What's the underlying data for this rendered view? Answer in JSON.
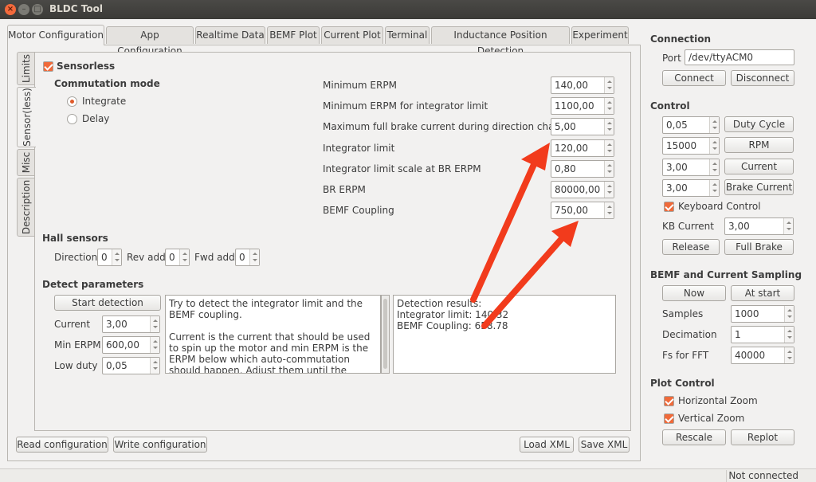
{
  "window": {
    "title": "BLDC Tool"
  },
  "tabs": [
    "Motor Configuration",
    "App Configuration",
    "Realtime Data",
    "BEMF Plot",
    "Current Plot",
    "Terminal",
    "Inductance Position Detection",
    "Experiment"
  ],
  "side_tabs": [
    "Limits",
    "Sensor(less)",
    "Misc",
    "Description"
  ],
  "sensorless": {
    "checkbox_label": "Sensorless",
    "commutation_title": "Commutation mode",
    "mode_integrate": "Integrate",
    "mode_delay": "Delay"
  },
  "params": [
    {
      "label": "Minimum ERPM",
      "value": "140,00"
    },
    {
      "label": "Minimum ERPM for integrator limit",
      "value": "1100,00"
    },
    {
      "label": "Maximum full brake current during direction change",
      "value": "5,00"
    },
    {
      "label": "Integrator limit",
      "value": "120,00"
    },
    {
      "label": "Integrator limit scale at BR ERPM",
      "value": "0,80"
    },
    {
      "label": "BR ERPM",
      "value": "80000,00"
    },
    {
      "label": "BEMF Coupling",
      "value": "750,00"
    }
  ],
  "hall": {
    "title": "Hall sensors",
    "direction_label": "Direction",
    "direction_value": "0",
    "rev_label": "Rev add",
    "rev_value": "0",
    "fwd_label": "Fwd add",
    "fwd_value": "0"
  },
  "detect": {
    "title": "Detect parameters",
    "start_button": "Start detection",
    "current_label": "Current",
    "current_value": "3,00",
    "min_erpm_label": "Min ERPM",
    "min_erpm_value": "600,00",
    "low_duty_label": "Low duty",
    "low_duty_value": "0,05",
    "help_text": "Try to detect the integrator limit and the BEMF coupling.\n\nCurrent is the current that should be used to spin up the motor and min ERPM is the ERPM below which auto-commutation should happen. Adjust them until the motor is able to spin up",
    "results_text": "Detection results:\nIntegrator limit: 140.32\nBEMF Coupling: 658.78"
  },
  "bottom_buttons": {
    "read": "Read configuration",
    "write": "Write configuration",
    "load": "Load XML",
    "save": "Save XML"
  },
  "connection": {
    "title": "Connection",
    "port_label": "Port",
    "port_value": "/dev/ttyACM0",
    "connect": "Connect",
    "disconnect": "Disconnect"
  },
  "control": {
    "title": "Control",
    "duty_value": "0,05",
    "duty_button": "Duty Cycle",
    "rpm_value": "15000",
    "rpm_button": "RPM",
    "current_value": "3,00",
    "current_button": "Current",
    "brake_value": "3,00",
    "brake_button": "Brake Current",
    "keyboard_label": "Keyboard Control",
    "kb_current_label": "KB Current",
    "kb_current_value": "3,00",
    "release": "Release",
    "full_brake": "Full Brake"
  },
  "bemf_sampling": {
    "title": "BEMF and Current Sampling",
    "now": "Now",
    "at_start": "At start",
    "samples_label": "Samples",
    "samples_value": "1000",
    "decimation_label": "Decimation",
    "decimation_value": "1",
    "fs_label": "Fs for FFT",
    "fs_value": "40000"
  },
  "plot_control": {
    "title": "Plot Control",
    "hzoom": "Horizontal Zoom",
    "vzoom": "Vertical Zoom",
    "rescale": "Rescale",
    "replot": "Replot"
  },
  "status": {
    "text": "Not connected"
  },
  "colors": {
    "accent": "#f06a3a",
    "arrow": "#f23b1c"
  }
}
